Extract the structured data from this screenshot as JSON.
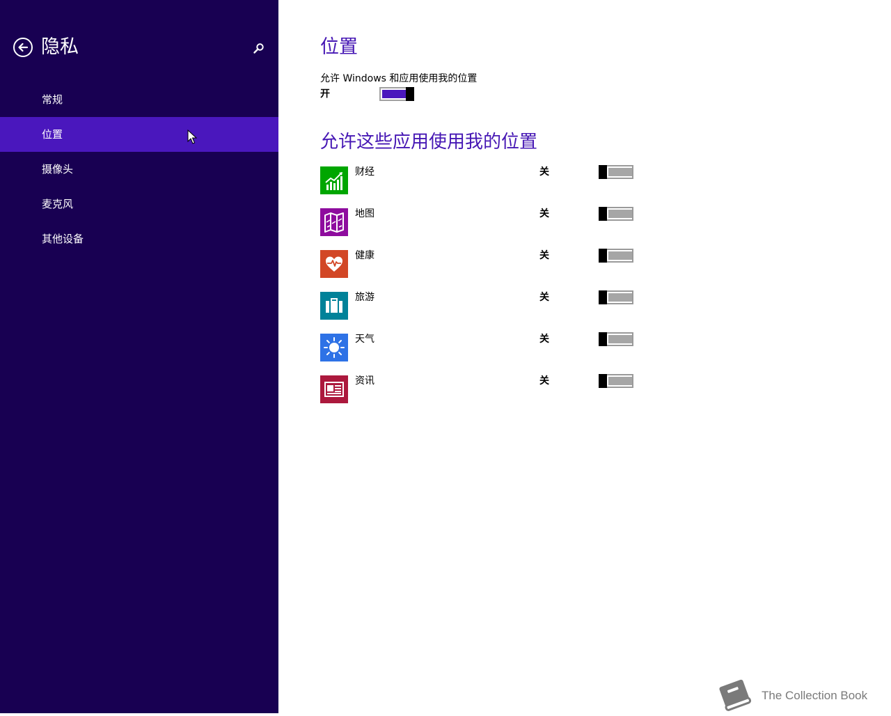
{
  "sidebar": {
    "title": "隐私",
    "items": [
      {
        "label": "常规"
      },
      {
        "label": "位置"
      },
      {
        "label": "摄像头"
      },
      {
        "label": "麦克风"
      },
      {
        "label": "其他设备"
      }
    ],
    "selected_index": 1
  },
  "main": {
    "title": "位置",
    "master_setting": {
      "description": "允许 Windows 和应用使用我的位置",
      "state_label": "开",
      "on": true
    },
    "apps_heading": "允许这些应用使用我的位置",
    "apps": [
      {
        "name": "财经",
        "state_label": "关",
        "on": false,
        "color": "#00a600",
        "icon": "finance-chart-icon"
      },
      {
        "name": "地图",
        "state_label": "关",
        "on": false,
        "color": "#8e0c9e",
        "icon": "map-icon"
      },
      {
        "name": "健康",
        "state_label": "关",
        "on": false,
        "color": "#d24726",
        "icon": "heart-pulse-icon"
      },
      {
        "name": "旅游",
        "state_label": "关",
        "on": false,
        "color": "#008299",
        "icon": "suitcase-icon"
      },
      {
        "name": "天气",
        "state_label": "关",
        "on": false,
        "color": "#2e72e6",
        "icon": "sun-icon"
      },
      {
        "name": "资讯",
        "state_label": "关",
        "on": false,
        "color": "#ac193d",
        "icon": "newspaper-icon"
      }
    ]
  },
  "colors": {
    "sidebar_bg": "#180052",
    "selected_bg": "#4a17bd",
    "accent": "#4617b4"
  },
  "watermark": {
    "text": "The Collection Book",
    "icon": "book-icon"
  }
}
